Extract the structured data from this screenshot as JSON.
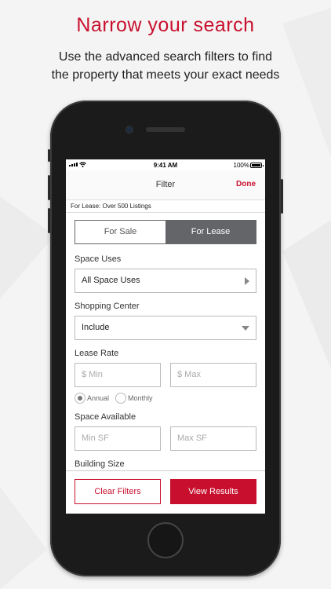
{
  "promo": {
    "headline": "Narrow your search",
    "subhead_line1": "Use the advanced search filters to find",
    "subhead_line2": "the property that meets your exact needs"
  },
  "status_bar": {
    "time": "9:41 AM",
    "battery": "100%"
  },
  "nav": {
    "title": "Filter",
    "done_label": "Done"
  },
  "info_strip": "For Lease: Over 500 Listings",
  "listing_type": {
    "options": [
      "For Sale",
      "For Lease"
    ],
    "selected": "For Lease"
  },
  "space_uses": {
    "label": "Space Uses",
    "value": "All Space Uses"
  },
  "shopping_center": {
    "label": "Shopping Center",
    "value": "Include"
  },
  "lease_rate": {
    "label": "Lease Rate",
    "min_placeholder": "$ Min",
    "max_placeholder": "$ Max",
    "period_options": [
      "Annual",
      "Monthly"
    ],
    "period_selected": "Annual"
  },
  "space_available": {
    "label": "Space Available",
    "min_placeholder": "Min SF",
    "max_placeholder": "Max SF"
  },
  "building_size": {
    "label": "Building Size"
  },
  "footer": {
    "clear_label": "Clear Filters",
    "view_label": "View Results"
  },
  "colors": {
    "accent": "#c8102e",
    "segment_selected": "#636569"
  }
}
